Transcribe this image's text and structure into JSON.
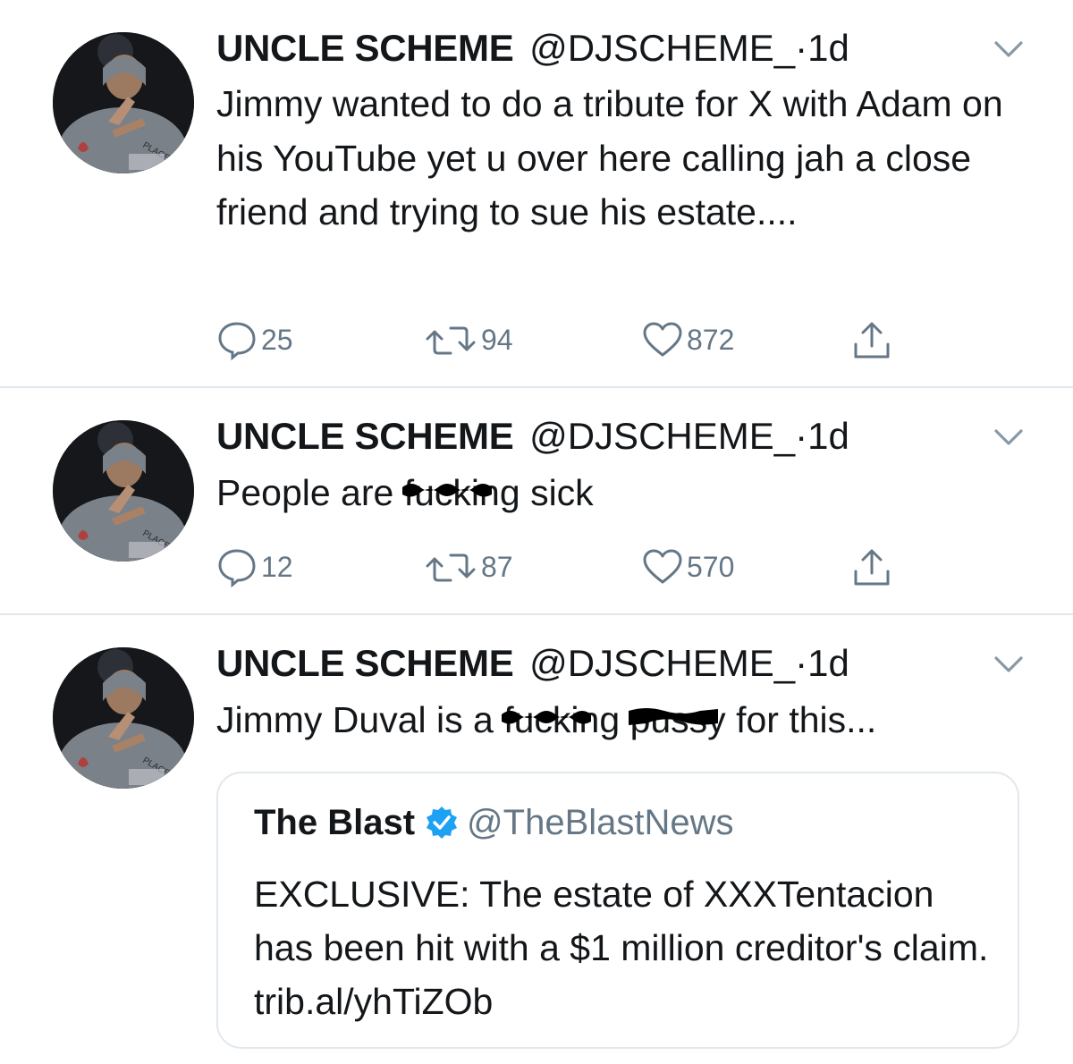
{
  "tweets": [
    {
      "name": "UNCLE SCHEME",
      "handle": "@DJSCHEME_",
      "dot": "·",
      "time": "1d",
      "text": "Jimmy wanted to do a tribute for X with Adam on his YouTube yet u over here calling jah a close friend and trying to sue his estate....",
      "replies": "25",
      "retweets": "94",
      "likes": "872"
    },
    {
      "name": "UNCLE SCHEME",
      "handle": "@DJSCHEME_",
      "dot": "·",
      "time": "1d",
      "text_before": "People are",
      "text_redacted": "fucking",
      "text_after": "sick",
      "replies": "12",
      "retweets": "87",
      "likes": "570"
    },
    {
      "name": "UNCLE SCHEME",
      "handle": "@DJSCHEME_",
      "dot": "·",
      "time": "1d",
      "text_before": "Jimmy Duval is a",
      "text_redacted_1": "fucking",
      "text_redacted_2": "pussy",
      "text_after": "for this...",
      "quote": {
        "name": "The Blast",
        "handle": "@TheBlastNews",
        "text": "EXCLUSIVE: The estate of XXXTentacion has been hit with a $1 million creditor's claim. trib.al/yhTiZOb"
      }
    }
  ],
  "icons": {
    "reply": "reply-icon",
    "retweet": "retweet-icon",
    "like": "heart-icon",
    "share": "share-icon",
    "menu": "chevron-down-icon",
    "verified": "verified-badge-icon"
  },
  "colors": {
    "text": "#14171a",
    "muted": "#657786",
    "verified": "#1da1f2",
    "divider": "#e1e8ed"
  }
}
